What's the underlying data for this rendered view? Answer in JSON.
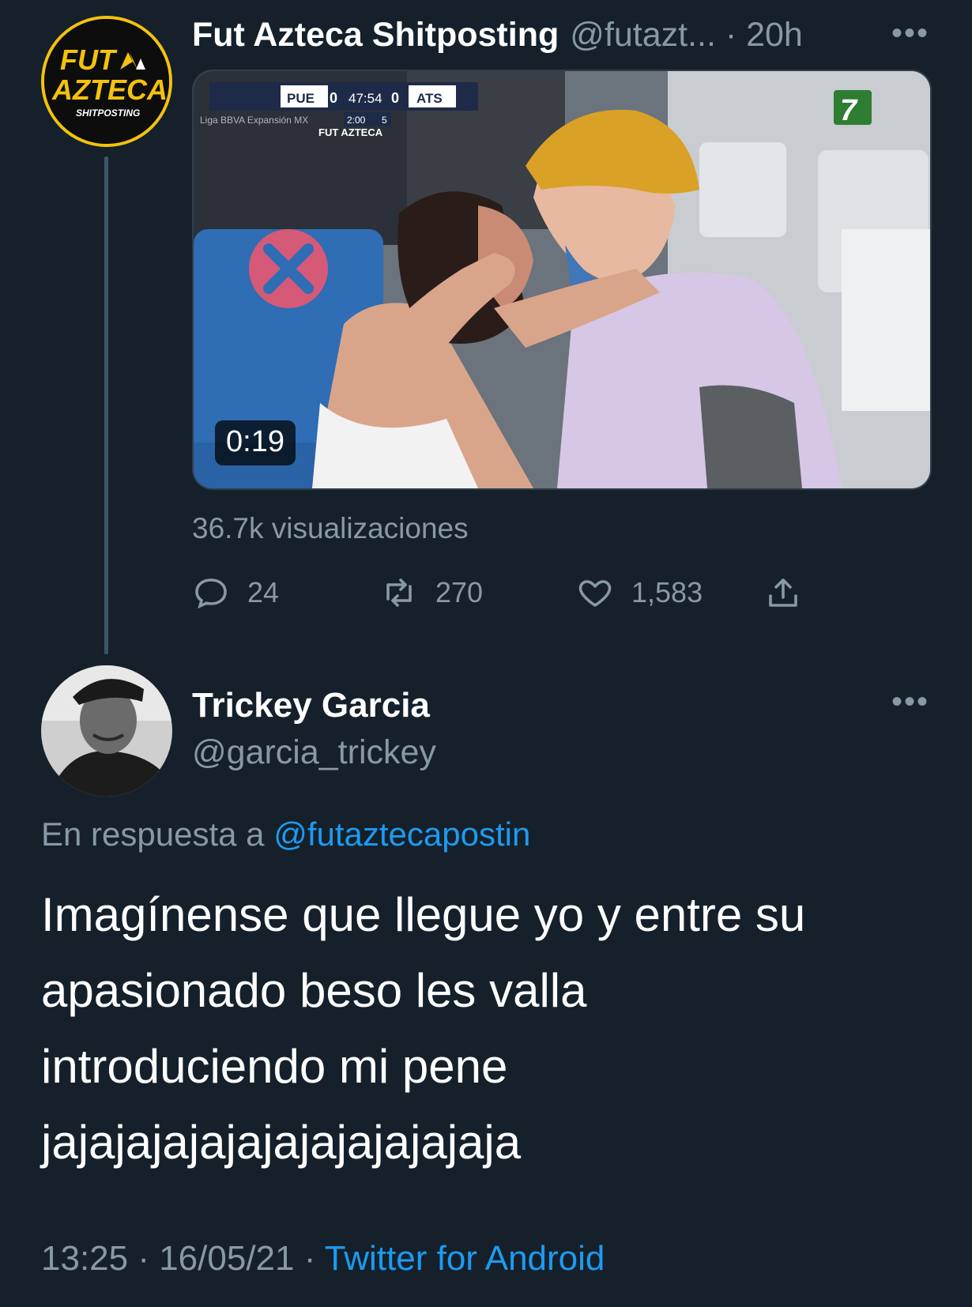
{
  "tweet": {
    "author_name": "Fut Azteca Shitposting",
    "author_meta": "@futazt... · 20h",
    "avatar_logo_line1": "FUT",
    "avatar_logo_line2": "AZTECA",
    "avatar_logo_line3": "SHITPOSTING",
    "more_icon": "ellipsis-icon",
    "video": {
      "duration": "0:19",
      "scoreboard_home": "PUE",
      "scoreboard_home_score": "0",
      "scoreboard_clock": "47:54",
      "scoreboard_away_score": "0",
      "scoreboard_away": "ATS",
      "scoreboard_sub": "2:00",
      "scoreboard_flag": "5",
      "league_text": "Liga BBVA Expansión MX",
      "watermark": "FUT AZTECA",
      "channel_logo": "7"
    },
    "views": "36.7k visualizaciones",
    "actions": {
      "reply_count": "24",
      "retweet_count": "270",
      "like_count": "1,583"
    }
  },
  "reply": {
    "author_name": "Trickey Garcia",
    "author_handle": "@garcia_trickey",
    "in_reply_prefix": "En respuesta a",
    "in_reply_handle": "@futaztecapostin",
    "body_lines": [
      "Imagínense que llegue yo y entre su",
      "apasionado beso les valla",
      "introduciendo mi pene",
      "jajajajajajajajajajajajaja"
    ],
    "timestamp": "13:25 · 16/05/21 ·",
    "source": "Twitter for Android"
  },
  "colors": {
    "background": "#15202b",
    "secondary_text": "#8899a6",
    "link": "#1d9bf0",
    "logo_ring": "#f4c20d"
  }
}
